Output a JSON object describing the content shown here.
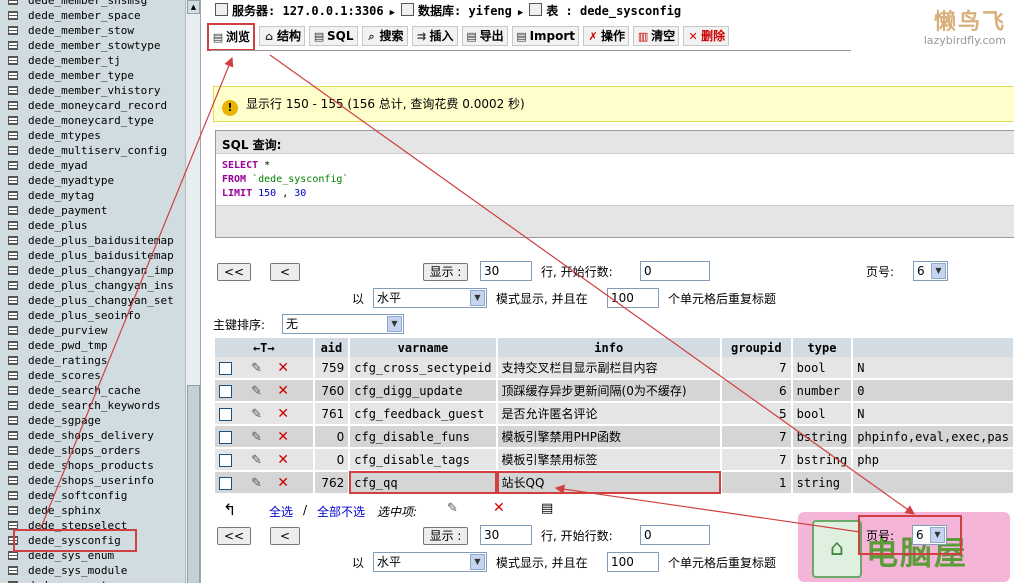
{
  "sidebar": {
    "tables": [
      "dede_member_snsmsg",
      "dede_member_space",
      "dede_member_stow",
      "dede_member_stowtype",
      "dede_member_tj",
      "dede_member_type",
      "dede_member_vhistory",
      "dede_moneycard_record",
      "dede_moneycard_type",
      "dede_mtypes",
      "dede_multiserv_config",
      "dede_myad",
      "dede_myadtype",
      "dede_mytag",
      "dede_payment",
      "dede_plus",
      "dede_plus_baidusitemap",
      "dede_plus_baidusitemap",
      "dede_plus_changyan_imp",
      "dede_plus_changyan_ins",
      "dede_plus_changyan_set",
      "dede_plus_seoinfo",
      "dede_purview",
      "dede_pwd_tmp",
      "dede_ratings",
      "dede_scores",
      "dede_search_cache",
      "dede_search_keywords",
      "dede_sgpage",
      "dede_shops_delivery",
      "dede_shops_orders",
      "dede_shops_products",
      "dede_shops_userinfo",
      "dede_softconfig",
      "dede_sphinx",
      "dede_stepselect",
      "dede_sysconfig",
      "dede_sys_enum",
      "dede_sys_module",
      "dede_sys_set"
    ],
    "selected": "dede_sysconfig"
  },
  "header": {
    "server_label": "服务器:",
    "server": "127.0.0.1:3306",
    "db_label": "数据库:",
    "db": "yifeng",
    "table_label": "表 :",
    "table": "dede_sysconfig"
  },
  "tabs": [
    {
      "label": "浏览",
      "icon": "browse-icon",
      "glyph": "▤"
    },
    {
      "label": "结构",
      "icon": "structure-icon",
      "glyph": "⌂"
    },
    {
      "label": "SQL",
      "icon": "sql-icon",
      "glyph": "▤"
    },
    {
      "label": "搜索",
      "icon": "search-icon",
      "glyph": "⌕"
    },
    {
      "label": "插入",
      "icon": "insert-icon",
      "glyph": "⇉"
    },
    {
      "label": "导出",
      "icon": "export-icon",
      "glyph": "▤"
    },
    {
      "label": "Import",
      "icon": "import-icon",
      "glyph": "▤"
    },
    {
      "label": "操作",
      "icon": "operations-icon",
      "glyph": "✗"
    },
    {
      "label": "清空",
      "icon": "empty-icon",
      "glyph": "▥"
    },
    {
      "label": "删除",
      "icon": "drop-icon",
      "glyph": "✕"
    }
  ],
  "logo": {
    "big": "懒鸟飞",
    "small": "lazybirdfly.com"
  },
  "notice": {
    "icon": "!",
    "text": "显示行 150 - 155 (156 总计, 查询花费 0.0002 秒)"
  },
  "sql": {
    "legend": "SQL 查询:",
    "line1_kw": "SELECT",
    "line1_rest": " *",
    "line2_kw": "FROM",
    "line2_rest": " `dede_sysconfig`",
    "line3_kw": "LIMIT",
    "line3_n1": "150",
    "line3_sep": " , ",
    "line3_n2": "30"
  },
  "nav": {
    "first": "<<",
    "prev": "<",
    "show_btn": "显示 :",
    "rows": "30",
    "start_label": "行, 开始行数:",
    "start": "0",
    "page_label": "页号:",
    "page": "6",
    "mode_prefix": "以",
    "mode": "水平",
    "mode_suffix": "模式显示, 并且在",
    "repeat": "100",
    "repeat_suffix": "个单元格后重复标题"
  },
  "sort": {
    "label": "主键排序:",
    "value": "无"
  },
  "table": {
    "columns": [
      "aid",
      "varname",
      "info",
      "groupid",
      "type",
      ""
    ],
    "rows": [
      {
        "aid": "759",
        "varname": "cfg_cross_sectypeid",
        "info": "支持交叉栏目显示副栏目内容",
        "groupid": "7",
        "type": "bool",
        "value": "N"
      },
      {
        "aid": "760",
        "varname": "cfg_digg_update",
        "info": "顶踩缓存异步更新间隔(0为不缓存)",
        "groupid": "6",
        "type": "number",
        "value": "0"
      },
      {
        "aid": "761",
        "varname": "cfg_feedback_guest",
        "info": "是否允许匿名评论",
        "groupid": "5",
        "type": "bool",
        "value": "N"
      },
      {
        "aid": "0",
        "varname": "cfg_disable_funs",
        "info": "模板引擎禁用PHP函数",
        "groupid": "7",
        "type": "bstring",
        "value": "phpinfo,eval,exec,pas"
      },
      {
        "aid": "0",
        "varname": "cfg_disable_tags",
        "info": "模板引擎禁用标签",
        "groupid": "7",
        "type": "bstring",
        "value": "php"
      },
      {
        "aid": "762",
        "varname": "cfg_qq",
        "info": "站长QQ",
        "groupid": "1",
        "type": "string",
        "value": ""
      }
    ]
  },
  "footer_actions": {
    "check_all": "全选",
    "sep": "/",
    "uncheck_all": "全部不选",
    "with_selected": "选中项:"
  },
  "watermark": {
    "text": "电脑屋"
  },
  "colors": {
    "highlight": "#d04040",
    "row_odd": "#E5E5E5",
    "row_even": "#D5D5D5",
    "header": "#D3DCE3",
    "sidebar": "#D0DCE0"
  }
}
